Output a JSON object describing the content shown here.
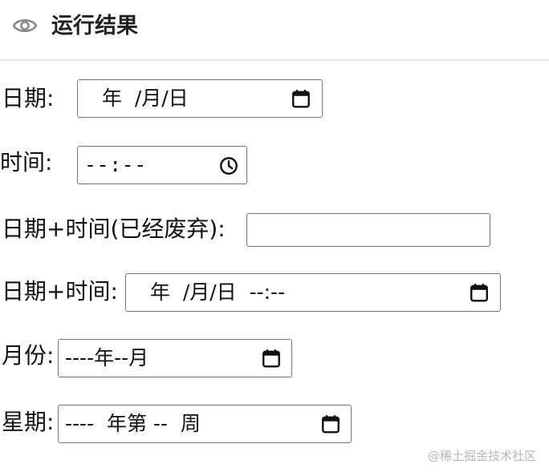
{
  "header": {
    "title": "运行结果",
    "icon": "eye-icon"
  },
  "fields": [
    {
      "label": "日期:",
      "value": " 年  /月/日",
      "icon": "calendar-icon"
    },
    {
      "label": "时间:",
      "value": "--:--",
      "icon": "clock-icon"
    },
    {
      "label": "日期+时间(已经废弃):",
      "value": ""
    },
    {
      "label": "日期+时间:",
      "value": " 年  /月/日  --:--",
      "icon": "calendar-icon"
    },
    {
      "label": "月份:",
      "value": "----年--月",
      "icon": "calendar-icon"
    },
    {
      "label": "星期:",
      "value": "----  年第 --  周",
      "icon": "calendar-icon"
    }
  ],
  "watermark": "@稀土掘金技术社区"
}
